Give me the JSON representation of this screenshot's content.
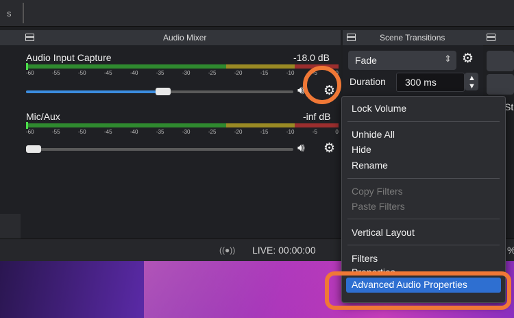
{
  "topbar": {
    "fragment": "s"
  },
  "audio_mixer": {
    "title": "Audio Mixer",
    "ticks": [
      "-60",
      "-55",
      "-50",
      "-45",
      "-40",
      "-35",
      "-30",
      "-25",
      "-20",
      "-15",
      "-10",
      "-5",
      "0"
    ],
    "channels": [
      {
        "name": "Audio Input Capture",
        "level": "-18.0 dB",
        "volume_fraction": 0.44
      },
      {
        "name": "Mic/Aux",
        "level": "-inf dB",
        "volume_fraction": 0.0
      }
    ]
  },
  "scene_transitions": {
    "title": "Scene Transitions",
    "transition": "Fade",
    "duration_label": "Duration",
    "duration_value": "300 ms",
    "right_edge_fragment": "St"
  },
  "context_menu": {
    "items": [
      {
        "label": "Lock Volume",
        "enabled": true
      },
      {
        "label": "Unhide All",
        "enabled": true
      },
      {
        "label": "Hide",
        "enabled": true
      },
      {
        "label": "Rename",
        "enabled": true
      },
      {
        "label": "Copy Filters",
        "enabled": false
      },
      {
        "label": "Paste Filters",
        "enabled": false
      },
      {
        "label": "Vertical Layout",
        "enabled": true
      },
      {
        "label": "Filters",
        "enabled": true
      },
      {
        "label": "Properties",
        "enabled": true
      },
      {
        "label": "Advanced Audio Properties",
        "enabled": true,
        "selected": true
      }
    ]
  },
  "statusbar": {
    "live": "LIVE: 00:00:00",
    "percent_fragment": "%"
  },
  "icons": {
    "dock": "dock-float-icon",
    "speaker": "speaker-icon",
    "gear": "gear-icon",
    "broadcast": "broadcast-icon",
    "spin": "spin-arrows-icon"
  },
  "colors": {
    "accent": "#2e6fd1",
    "annotation": "#f07836",
    "meter_green": "#2f8a2f",
    "meter_yellow": "#9a8a24",
    "meter_red": "#9b2e2e",
    "slider_fill": "#3b8de0"
  }
}
